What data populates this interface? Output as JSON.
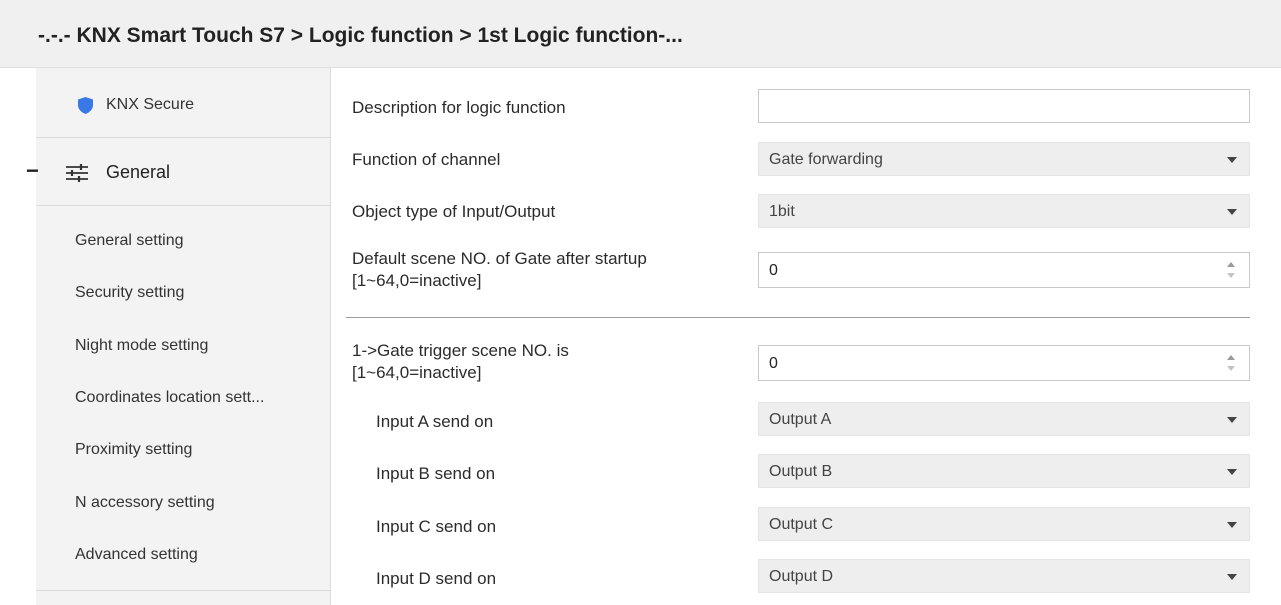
{
  "window": {
    "title": "-.-.- KNX Smart Touch S7 > Logic function > 1st Logic function-..."
  },
  "sidebar": {
    "secure_label": "KNX Secure",
    "general_toggle": "−",
    "general_label": "General",
    "items": [
      "General setting",
      "Security setting",
      "Night mode setting",
      "Coordinates location sett...",
      "Proximity setting",
      "N accessory setting",
      "Advanced setting"
    ]
  },
  "form": {
    "description_label": "Description for logic function",
    "description_value": "",
    "function_label": "Function of channel",
    "function_value": "Gate forwarding",
    "object_type_label": "Object type of Input/Output",
    "object_type_value": "1bit",
    "default_scene_label_1": "Default scene NO. of Gate after startup",
    "default_scene_label_2": "[1~64,0=inactive]",
    "default_scene_value": "0",
    "trigger_scene_label_1": "1->Gate trigger scene NO. is",
    "trigger_scene_label_2": "[1~64,0=inactive]",
    "trigger_scene_value": "0",
    "inputs": [
      {
        "label": "Input A send on",
        "value": "Output A"
      },
      {
        "label": "Input B send on",
        "value": "Output B"
      },
      {
        "label": "Input C send on",
        "value": "Output C"
      },
      {
        "label": "Input D send on",
        "value": "Output D"
      }
    ]
  },
  "colors": {
    "accent_shield": "#3b78e7",
    "combo_bg": "#eeeeee",
    "sidebar_bg": "#f3f3f3"
  },
  "icons": {
    "secure": "shield-icon",
    "general": "sliders-icon",
    "dropdown": "caret-down-icon",
    "spin": "spin-arrows-icon"
  }
}
